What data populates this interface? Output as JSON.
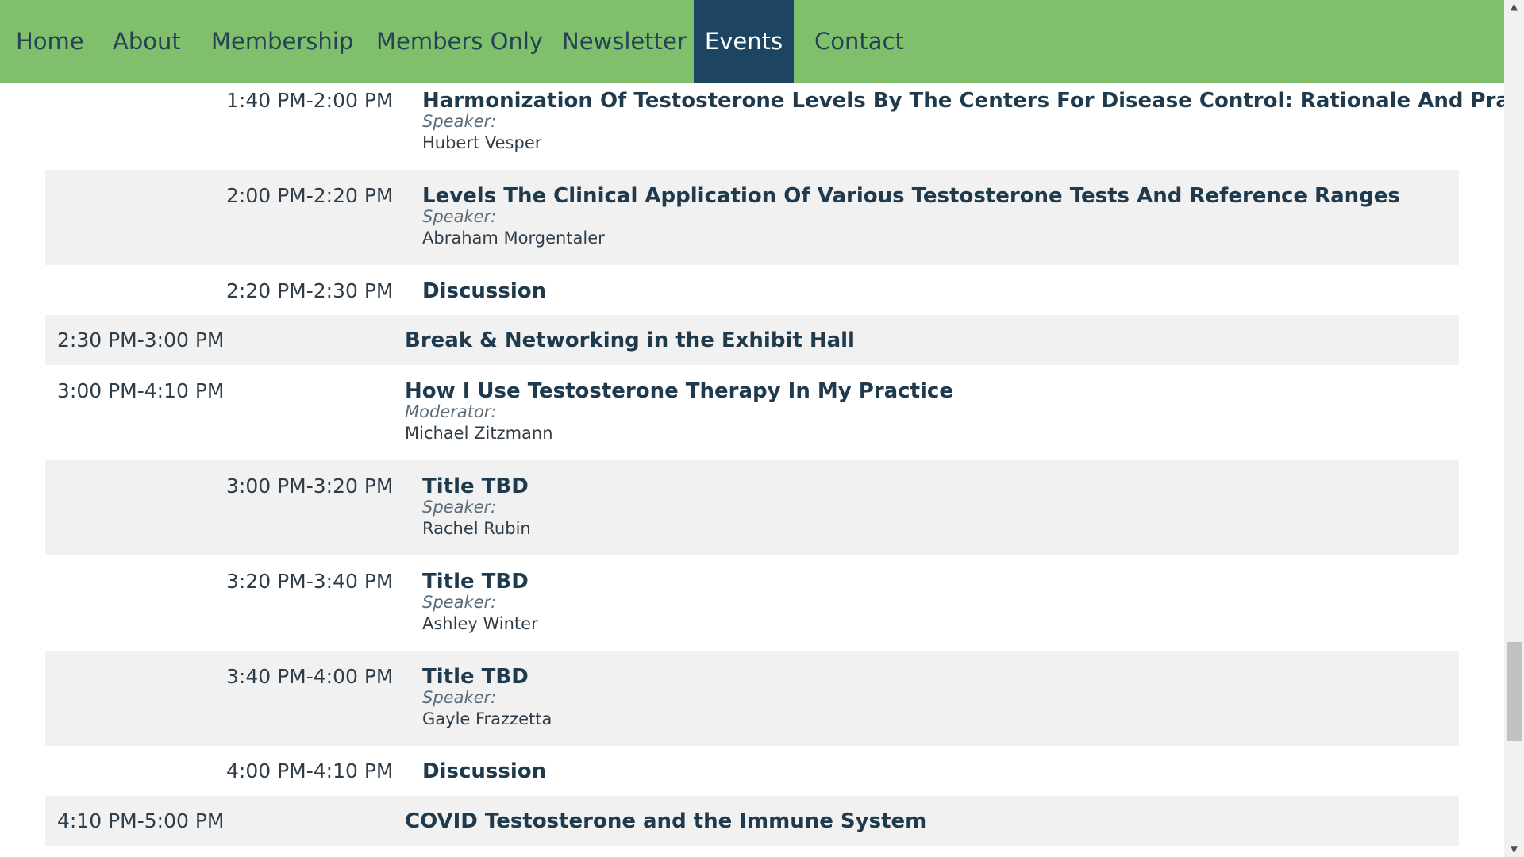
{
  "nav": {
    "items": [
      {
        "label": "Home"
      },
      {
        "label": "About"
      },
      {
        "label": "Membership"
      },
      {
        "label": "Members Only"
      },
      {
        "label": "Newsletter"
      },
      {
        "label": "Events",
        "active": true
      },
      {
        "label": "Contact"
      }
    ],
    "bar_color": "#80c06c",
    "active_color": "#1d4461"
  },
  "schedule": [
    {
      "time": "1:40 PM-2:00 PM",
      "title": "Harmonization Of Testosterone Levels By The Centers For Disease Control: Rationale And Practice",
      "role": "Speaker:",
      "person": "Hubert Vesper"
    },
    {
      "time": "2:00 PM-2:20 PM",
      "title": "Levels The Clinical Application Of Various Testosterone Tests And Reference Ranges",
      "role": "Speaker:",
      "person": "Abraham Morgentaler"
    },
    {
      "time": "2:20 PM-2:30 PM",
      "title": "Discussion"
    },
    {
      "time": "2:30 PM-3:00 PM",
      "title": "Break & Networking in the Exhibit Hall"
    },
    {
      "time": "3:00 PM-4:10 PM",
      "title": "How I Use Testosterone Therapy In My Practice",
      "role": "Moderator:",
      "person": "Michael Zitzmann"
    },
    {
      "time": "3:00 PM-3:20 PM",
      "title": "Title TBD",
      "role": "Speaker:",
      "person": "Rachel Rubin"
    },
    {
      "time": "3:20 PM-3:40 PM",
      "title": "Title TBD",
      "role": "Speaker:",
      "person": "Ashley Winter"
    },
    {
      "time": "3:40 PM-4:00 PM",
      "title": "Title TBD",
      "role": "Speaker:",
      "person": "Gayle Frazzetta"
    },
    {
      "time": "4:00 PM-4:10 PM",
      "title": "Discussion"
    },
    {
      "time": "4:10 PM-5:00 PM",
      "title": "COVID Testosterone and the Immune System"
    }
  ],
  "scrollbar": {
    "up_icon": "arrow-up-icon",
    "down_icon": "arrow-down-icon",
    "position": 0.78
  }
}
